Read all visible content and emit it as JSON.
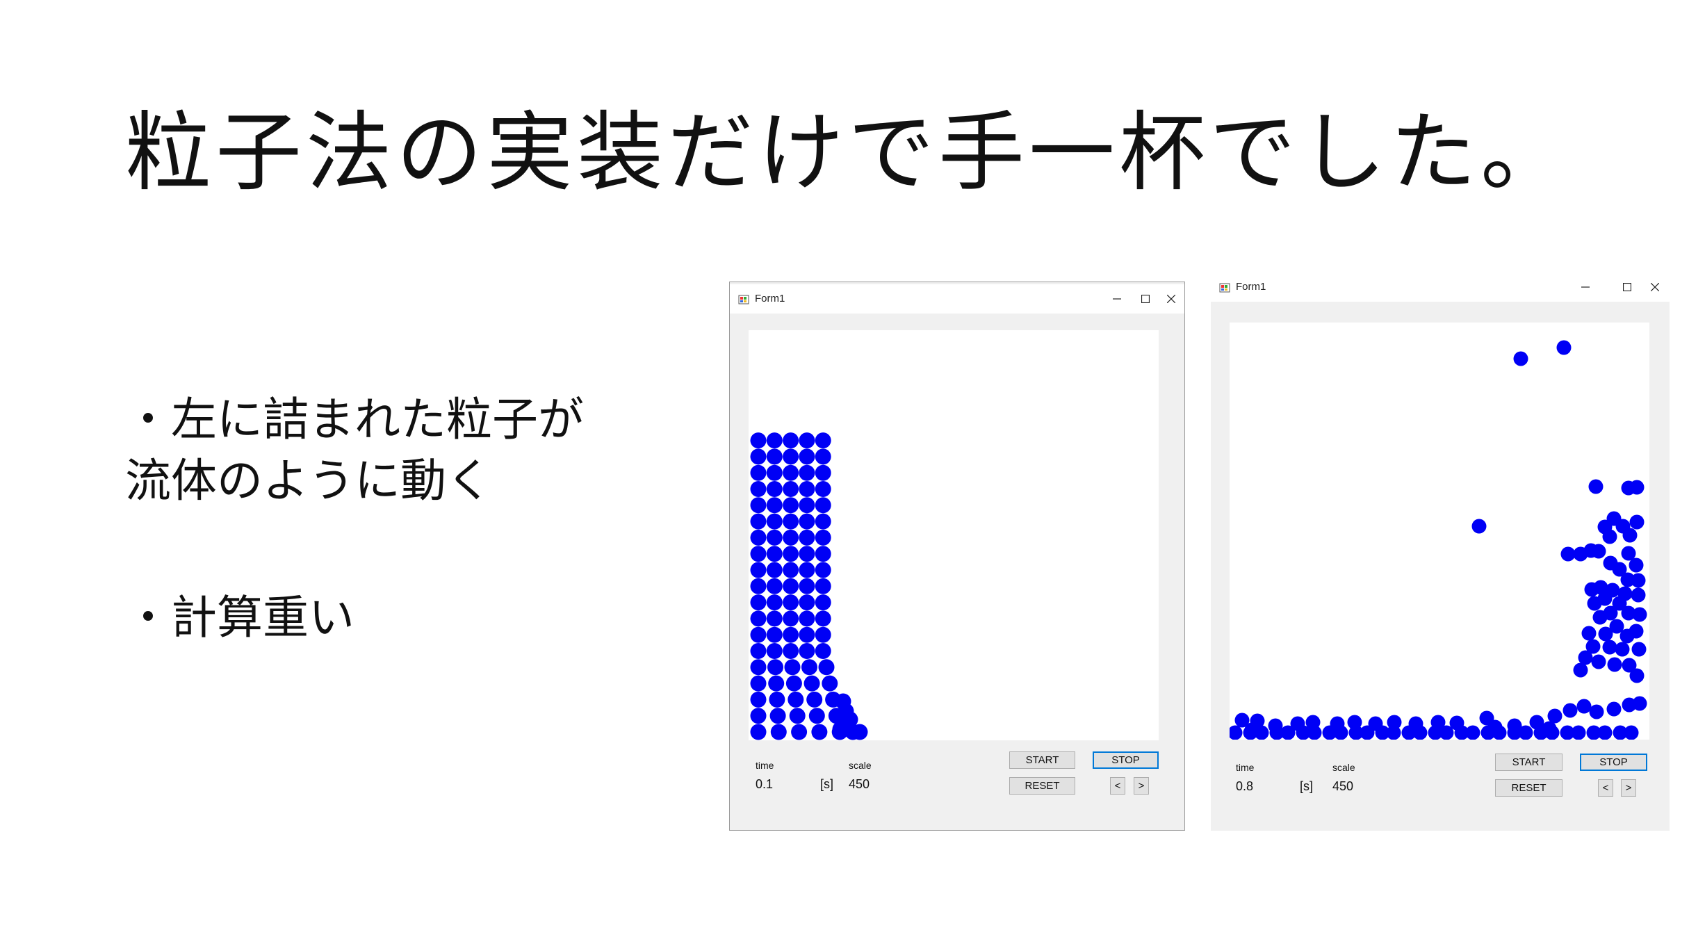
{
  "slide": {
    "title": "粒子法の実装だけで手一杯でした。",
    "bullets": [
      {
        "lines": [
          "・左に詰まれた粒子が",
          "流体のように動く"
        ]
      },
      {
        "lines": [
          "・計算重い"
        ]
      }
    ]
  },
  "colors": {
    "particle": "#0000f5",
    "focus_border": "#0078d7"
  },
  "windows": [
    {
      "title": "Form1",
      "icons": [
        "app-icon",
        "minimize-icon",
        "maximize-icon",
        "close-icon"
      ],
      "time_label": "time",
      "time_value": "0.1",
      "unit": "[s]",
      "scale_label": "scale",
      "scale_value": "450",
      "buttons": {
        "start": "START",
        "stop": "STOP",
        "reset": "RESET",
        "prev": "<",
        "next": ">"
      }
    },
    {
      "title": "Form1",
      "icons": [
        "app-icon",
        "minimize-icon",
        "maximize-icon",
        "close-icon"
      ],
      "time_label": "time",
      "time_value": "0.8",
      "unit": "[s]",
      "scale_label": "scale",
      "scale_value": "450",
      "buttons": {
        "start": "START",
        "stop": "STOP",
        "reset": "RESET",
        "prev": "<",
        "next": ">"
      }
    }
  ]
}
